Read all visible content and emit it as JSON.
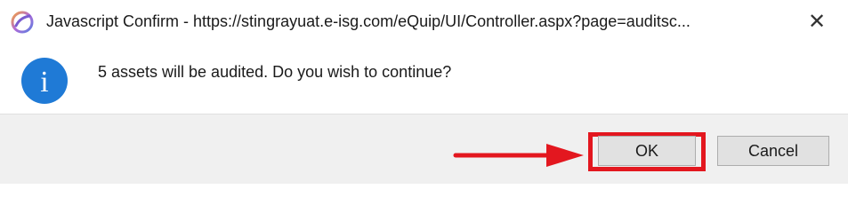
{
  "window": {
    "title": "Javascript Confirm - https://stingrayuat.e-isg.com/eQuip/UI/Controller.aspx?page=auditsc...",
    "close_glyph": "✕",
    "app_icon": "browser-swirl-icon"
  },
  "content": {
    "icon": "info-icon",
    "info_glyph": "i",
    "message": "5 assets will be audited. Do you wish to continue?"
  },
  "footer": {
    "ok_label": "OK",
    "cancel_label": "Cancel"
  },
  "annotation": {
    "color": "#e3171f",
    "target": "OK"
  },
  "colors": {
    "info_blue": "#1f7ad6",
    "footer_bg": "#f0f0f0",
    "button_bg": "#e1e1e1",
    "highlight_red": "#e3171f"
  }
}
